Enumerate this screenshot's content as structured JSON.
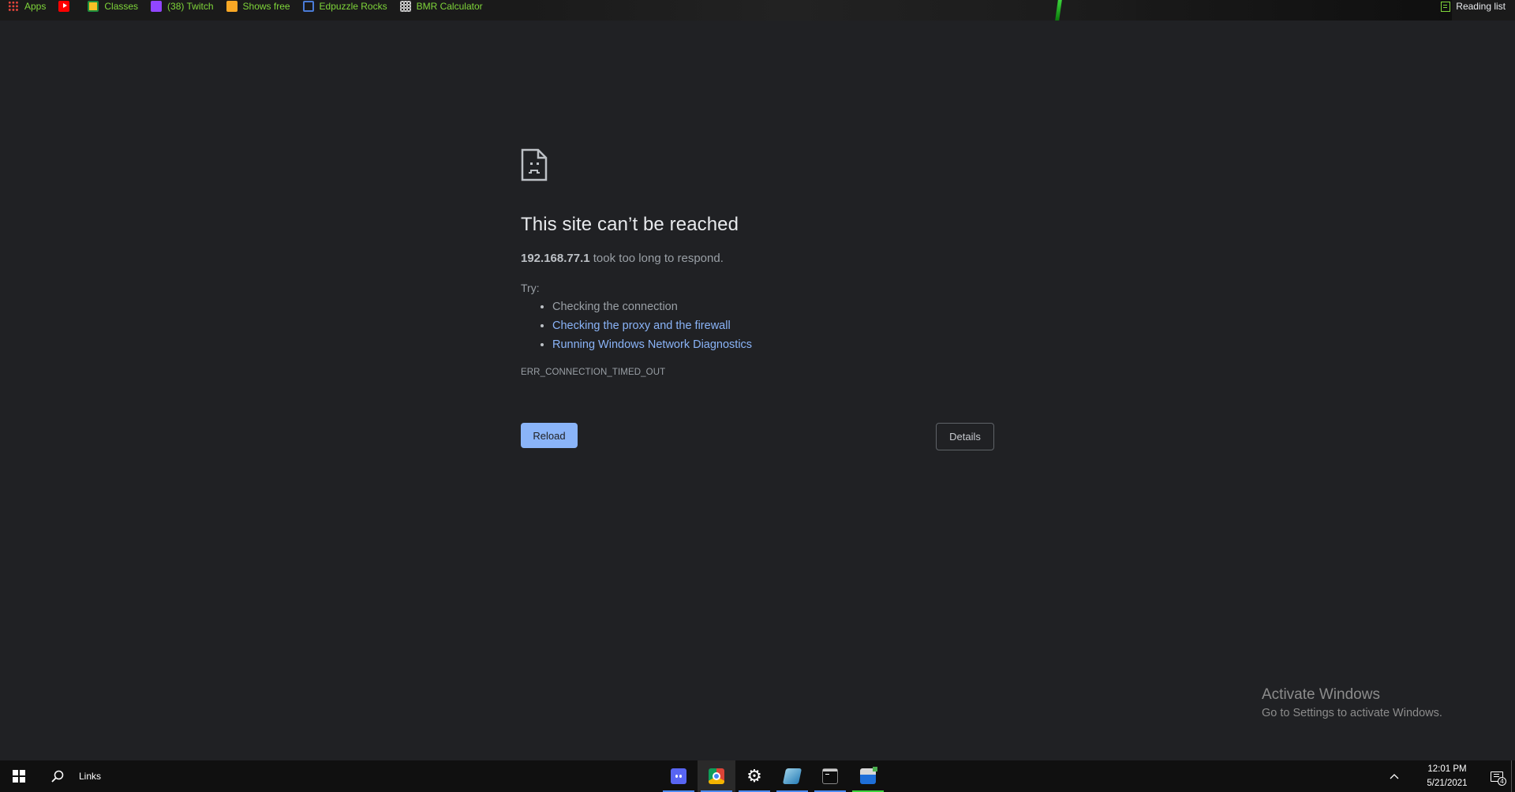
{
  "bookmarks": {
    "items": [
      {
        "label": "Apps",
        "icon": "apps-grid-icon"
      },
      {
        "label": "",
        "icon": "youtube-icon"
      },
      {
        "label": "Classes",
        "icon": "classroom-icon"
      },
      {
        "label": "(38) Twitch",
        "icon": "twitch-icon"
      },
      {
        "label": "Shows free",
        "icon": "shows-icon"
      },
      {
        "label": "Edpuzzle Rocks",
        "icon": "edpuzzle-icon"
      },
      {
        "label": "BMR Calculator",
        "icon": "calculator-icon"
      }
    ],
    "reading_list": "Reading list",
    "text_color": "#7fd63a"
  },
  "error": {
    "title": "This site can’t be reached",
    "host": "192.168.77.1",
    "message": " took too long to respond.",
    "try_label": "Try:",
    "suggestions": [
      {
        "text": "Checking the connection",
        "link": false
      },
      {
        "text": "Checking the proxy and the firewall",
        "link": true
      },
      {
        "text": "Running Windows Network Diagnostics",
        "link": true
      }
    ],
    "code": "ERR_CONNECTION_TIMED_OUT",
    "reload_label": "Reload",
    "details_label": "Details",
    "accent": "#8ab4f8"
  },
  "watermark": {
    "line1": "Activate Windows",
    "line2": "Go to Settings to activate Windows."
  },
  "taskbar": {
    "links_label": "Links",
    "apps": [
      {
        "name": "discord",
        "icon": "discord-icon",
        "active": false,
        "underline": "#4c8bf5"
      },
      {
        "name": "chrome",
        "icon": "chrome-icon",
        "active": true,
        "underline": "#4c8bf5"
      },
      {
        "name": "settings",
        "icon": "gear-icon",
        "active": false,
        "underline": "#4c8bf5"
      },
      {
        "name": "editor",
        "icon": "editor-icon",
        "active": false,
        "underline": "#4c8bf5"
      },
      {
        "name": "terminal",
        "icon": "terminal-icon",
        "active": false,
        "underline": "#4c8bf5"
      },
      {
        "name": "snipping",
        "icon": "snip-icon",
        "active": false,
        "underline": "#3cd43c"
      }
    ],
    "time": "12:01 PM",
    "date": "5/21/2021",
    "notification_count": "4"
  }
}
